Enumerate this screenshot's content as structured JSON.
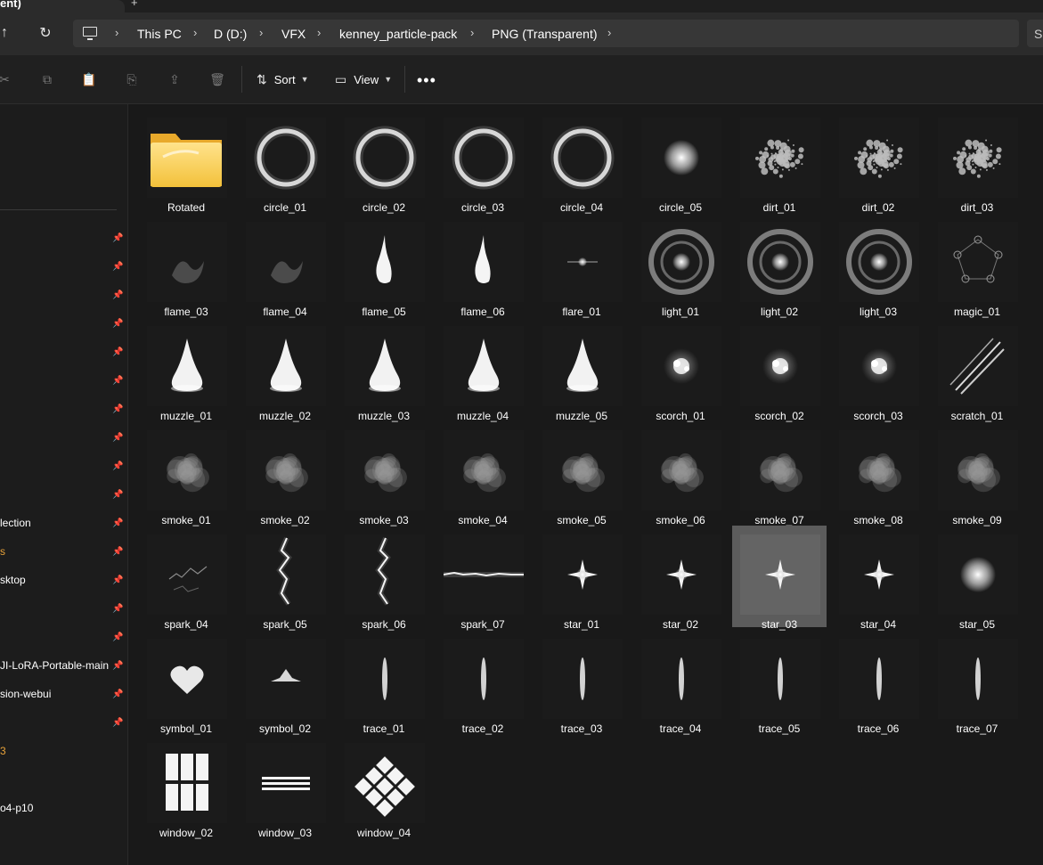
{
  "window": {
    "tab_title": "ent)",
    "new_tab": "+"
  },
  "breadcrumb": [
    "This PC",
    "D (D:)",
    "VFX",
    "kenney_particle-pack",
    "PNG (Transparent)"
  ],
  "search": {
    "visible_text": "S"
  },
  "toolbar": {
    "sort_label": "Sort",
    "view_label": "View",
    "more_label": "•••",
    "icons": [
      "cut-icon",
      "copy-icon",
      "paste-icon",
      "rename-icon",
      "share-icon",
      "delete-icon"
    ]
  },
  "sidebar": {
    "items": [
      {
        "label": "lection",
        "color": "#ffffff"
      },
      {
        "label": "s",
        "color": "#e7a23a"
      },
      {
        "label": "sktop",
        "color": "#ffffff"
      },
      {
        "label": "JI-LoRA-Portable-main",
        "color": "#ffffff"
      },
      {
        "label": "sion-webui",
        "color": "#ffffff"
      },
      {
        "label": "3",
        "color": "#e7a23a"
      },
      {
        "label": "o4-p10",
        "color": "#ffffff"
      }
    ]
  },
  "files": [
    {
      "name": "Rotated",
      "thumb": "folder-icon"
    },
    {
      "name": "circle_01",
      "thumb": "circle"
    },
    {
      "name": "circle_02",
      "thumb": "circle"
    },
    {
      "name": "circle_03",
      "thumb": "circle"
    },
    {
      "name": "circle_04",
      "thumb": "circle"
    },
    {
      "name": "circle_05",
      "thumb": "glow"
    },
    {
      "name": "dirt_01",
      "thumb": "dirt"
    },
    {
      "name": "dirt_02",
      "thumb": "dirt"
    },
    {
      "name": "dirt_03",
      "thumb": "dirt"
    },
    {
      "name": "flame_03",
      "thumb": "wisp"
    },
    {
      "name": "flame_04",
      "thumb": "wisp"
    },
    {
      "name": "flame_05",
      "thumb": "flame"
    },
    {
      "name": "flame_06",
      "thumb": "flame"
    },
    {
      "name": "flare_01",
      "thumb": "flare"
    },
    {
      "name": "light_01",
      "thumb": "light"
    },
    {
      "name": "light_02",
      "thumb": "light"
    },
    {
      "name": "light_03",
      "thumb": "light"
    },
    {
      "name": "magic_01",
      "thumb": "magic"
    },
    {
      "name": "muzzle_01",
      "thumb": "muzzle"
    },
    {
      "name": "muzzle_02",
      "thumb": "muzzle"
    },
    {
      "name": "muzzle_03",
      "thumb": "muzzle"
    },
    {
      "name": "muzzle_04",
      "thumb": "muzzle"
    },
    {
      "name": "muzzle_05",
      "thumb": "muzzle"
    },
    {
      "name": "scorch_01",
      "thumb": "scorch"
    },
    {
      "name": "scorch_02",
      "thumb": "scorch"
    },
    {
      "name": "scorch_03",
      "thumb": "scorch"
    },
    {
      "name": "scratch_01",
      "thumb": "scratch"
    },
    {
      "name": "smoke_01",
      "thumb": "smoke"
    },
    {
      "name": "smoke_02",
      "thumb": "smoke"
    },
    {
      "name": "smoke_03",
      "thumb": "smoke"
    },
    {
      "name": "smoke_04",
      "thumb": "smoke"
    },
    {
      "name": "smoke_05",
      "thumb": "smoke"
    },
    {
      "name": "smoke_06",
      "thumb": "smoke"
    },
    {
      "name": "smoke_07",
      "thumb": "smoke"
    },
    {
      "name": "smoke_08",
      "thumb": "smoke"
    },
    {
      "name": "smoke_09",
      "thumb": "smoke"
    },
    {
      "name": "spark_04",
      "thumb": "spark"
    },
    {
      "name": "spark_05",
      "thumb": "bolt"
    },
    {
      "name": "spark_06",
      "thumb": "bolt"
    },
    {
      "name": "spark_07",
      "thumb": "hbolt"
    },
    {
      "name": "star_01",
      "thumb": "star"
    },
    {
      "name": "star_02",
      "thumb": "star"
    },
    {
      "name": "star_03",
      "thumb": "star",
      "selected": true
    },
    {
      "name": "star_04",
      "thumb": "star"
    },
    {
      "name": "star_05",
      "thumb": "glow"
    },
    {
      "name": "symbol_01",
      "thumb": "heart"
    },
    {
      "name": "symbol_02",
      "thumb": "symbol"
    },
    {
      "name": "trace_01",
      "thumb": "trace"
    },
    {
      "name": "trace_02",
      "thumb": "trace"
    },
    {
      "name": "trace_03",
      "thumb": "trace"
    },
    {
      "name": "trace_04",
      "thumb": "trace"
    },
    {
      "name": "trace_05",
      "thumb": "trace"
    },
    {
      "name": "trace_06",
      "thumb": "trace"
    },
    {
      "name": "trace_07",
      "thumb": "trace"
    },
    {
      "name": "window_02",
      "thumb": "window-grid"
    },
    {
      "name": "window_03",
      "thumb": "window-lines"
    },
    {
      "name": "window_04",
      "thumb": "window-diamond"
    }
  ]
}
